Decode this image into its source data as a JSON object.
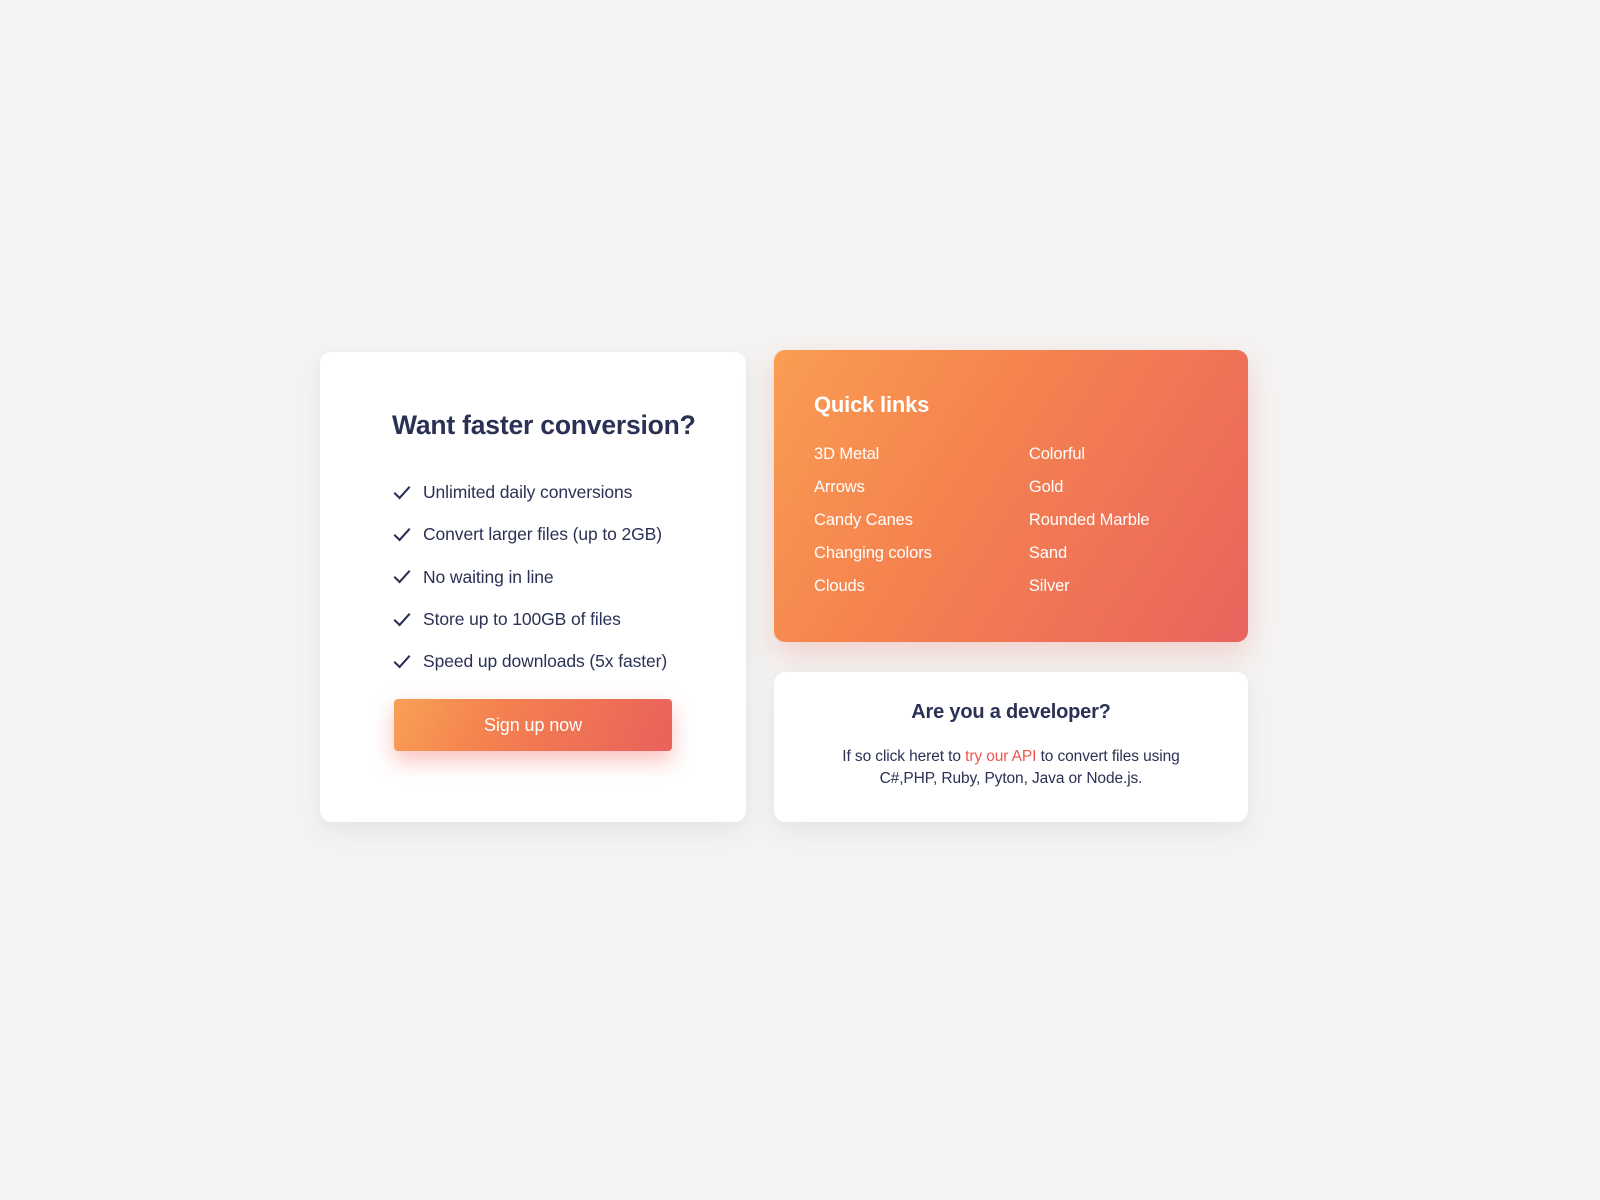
{
  "theme": {
    "page_background": "#f4f4f3",
    "heading_color": "#2b3154",
    "gradient_start": "#fa9d52",
    "gradient_end": "#e8635e",
    "link_accent": "#f0564b",
    "card_background": "#ffffff"
  },
  "promo": {
    "title": "Want faster conversion?",
    "features": [
      {
        "icon": "check-icon",
        "label": "Unlimited daily conversions"
      },
      {
        "icon": "check-icon",
        "label": "Convert larger files (up to 2GB)"
      },
      {
        "icon": "check-icon",
        "label": "No waiting in line"
      },
      {
        "icon": "check-icon",
        "label": "Store up to 100GB of files"
      },
      {
        "icon": "check-icon",
        "label": "Speed up downloads (5x faster)"
      }
    ],
    "signup_label": "Sign up now"
  },
  "quicklinks": {
    "title": "Quick links",
    "column_left": [
      {
        "label": "3D Metal"
      },
      {
        "label": "Arrows"
      },
      {
        "label": "Candy Canes"
      },
      {
        "label": "Changing colors"
      },
      {
        "label": "Clouds"
      }
    ],
    "column_right": [
      {
        "label": "Colorful"
      },
      {
        "label": "Gold"
      },
      {
        "label": "Rounded Marble"
      },
      {
        "label": "Sand"
      },
      {
        "label": "Silver"
      }
    ]
  },
  "developer": {
    "title": "Are you a developer?",
    "text_before": "If so click heret to ",
    "link_label": "try our API",
    "text_after": " to convert files using C#,PHP, Ruby, Pyton, Java or Node.js."
  }
}
